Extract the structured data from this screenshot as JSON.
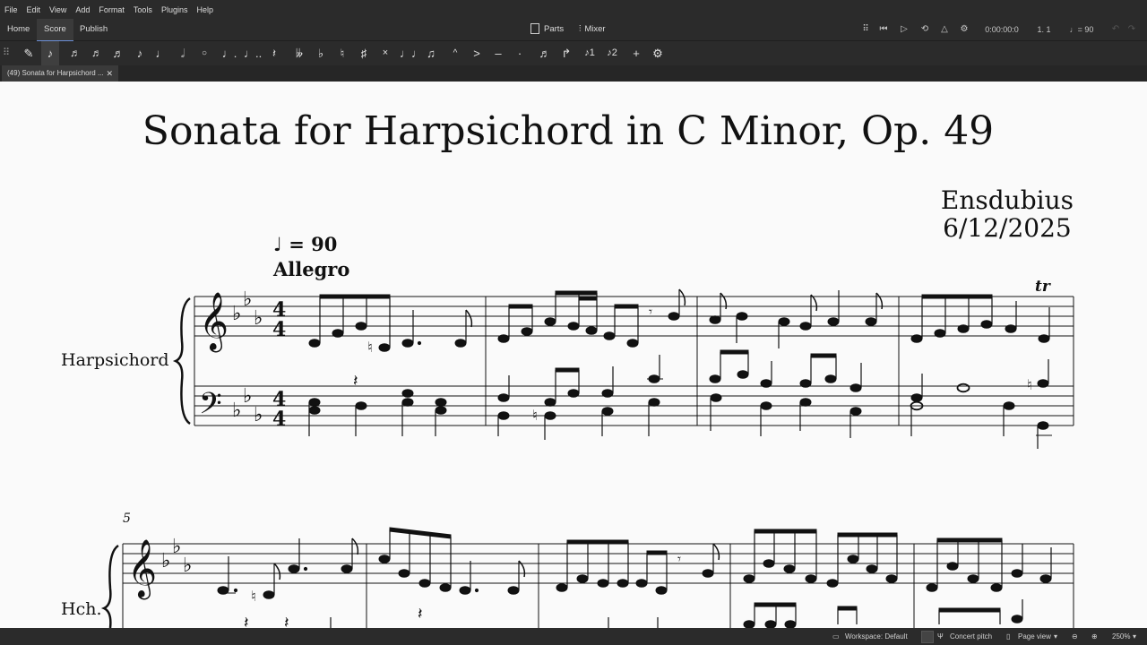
{
  "menu": [
    "File",
    "Edit",
    "View",
    "Add",
    "Format",
    "Tools",
    "Plugins",
    "Help"
  ],
  "nav_tabs": [
    "Home",
    "Score",
    "Publish"
  ],
  "panels": {
    "parts": "Parts",
    "mixer": "Mixer"
  },
  "playback": {
    "time": "0:00:00:0",
    "position": "1. 1",
    "tempo": "= 90"
  },
  "doc_tab": "(49) Sonata for Harpsichord ...",
  "score": {
    "title": "Sonata for Harpsichord in C Minor, Op. 49",
    "composer": "Ensdubius",
    "date": "6/12/2025",
    "tempo_mark": "= 90",
    "tempo_text": "Allegro",
    "instrument": "Harpsichord",
    "instrument_short": "Hch.",
    "time_sig": "4",
    "measure_start_system2": "5",
    "ornament": "tr"
  },
  "status": {
    "workspace": "Workspace: Default",
    "concert_pitch": "Concert pitch",
    "view": "Page view",
    "zoom": "250%"
  }
}
